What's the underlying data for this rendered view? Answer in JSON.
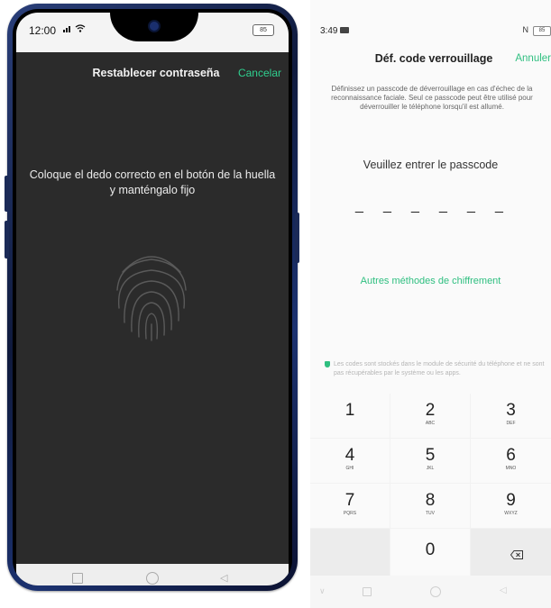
{
  "left_phone": {
    "status": {
      "time": "12:00",
      "signal": "⫪⫫",
      "battery": "85"
    },
    "header": {
      "title": "Restablecer contraseña",
      "cancel_label": "Cancelar"
    },
    "instruction": "Coloque el dedo correcto en el botón de la huella y manténgalo fijo",
    "nav": {
      "back_glyph": "◁"
    }
  },
  "right_screen": {
    "status": {
      "time": "3:49",
      "nfc": "N",
      "battery": "85"
    },
    "header": {
      "title": "Déf. code verrouillage",
      "cancel_label": "Annuler"
    },
    "description": "Définissez un passcode de déverrouillage en cas d'échec de la reconnaissance faciale. Seul ce passcode peut être utilisé pour déverrouiller le téléphone lorsqu'il est allumé.",
    "prompt": "Veuillez entrer le passcode",
    "dash_char": "_",
    "other_methods": "Autres méthodes de chiffrement",
    "security_note": "Les codes sont stockés dans le module de sécurité du téléphone et ne sont pas récupérables par le système ou les apps.",
    "keypad": {
      "keys": [
        {
          "num": "1",
          "sub": ""
        },
        {
          "num": "2",
          "sub": "ABC"
        },
        {
          "num": "3",
          "sub": "DEF"
        },
        {
          "num": "4",
          "sub": "GHI"
        },
        {
          "num": "5",
          "sub": "JKL"
        },
        {
          "num": "6",
          "sub": "MNO"
        },
        {
          "num": "7",
          "sub": "PQRS"
        },
        {
          "num": "8",
          "sub": "TUV"
        },
        {
          "num": "9",
          "sub": "WXYZ"
        },
        {
          "num": "0",
          "sub": ""
        }
      ]
    },
    "nav": {
      "down_glyph": "∨",
      "back_glyph": "◁"
    }
  },
  "colors": {
    "accent_green": "#2fbf80",
    "dark_bg": "#2b2b2b"
  }
}
